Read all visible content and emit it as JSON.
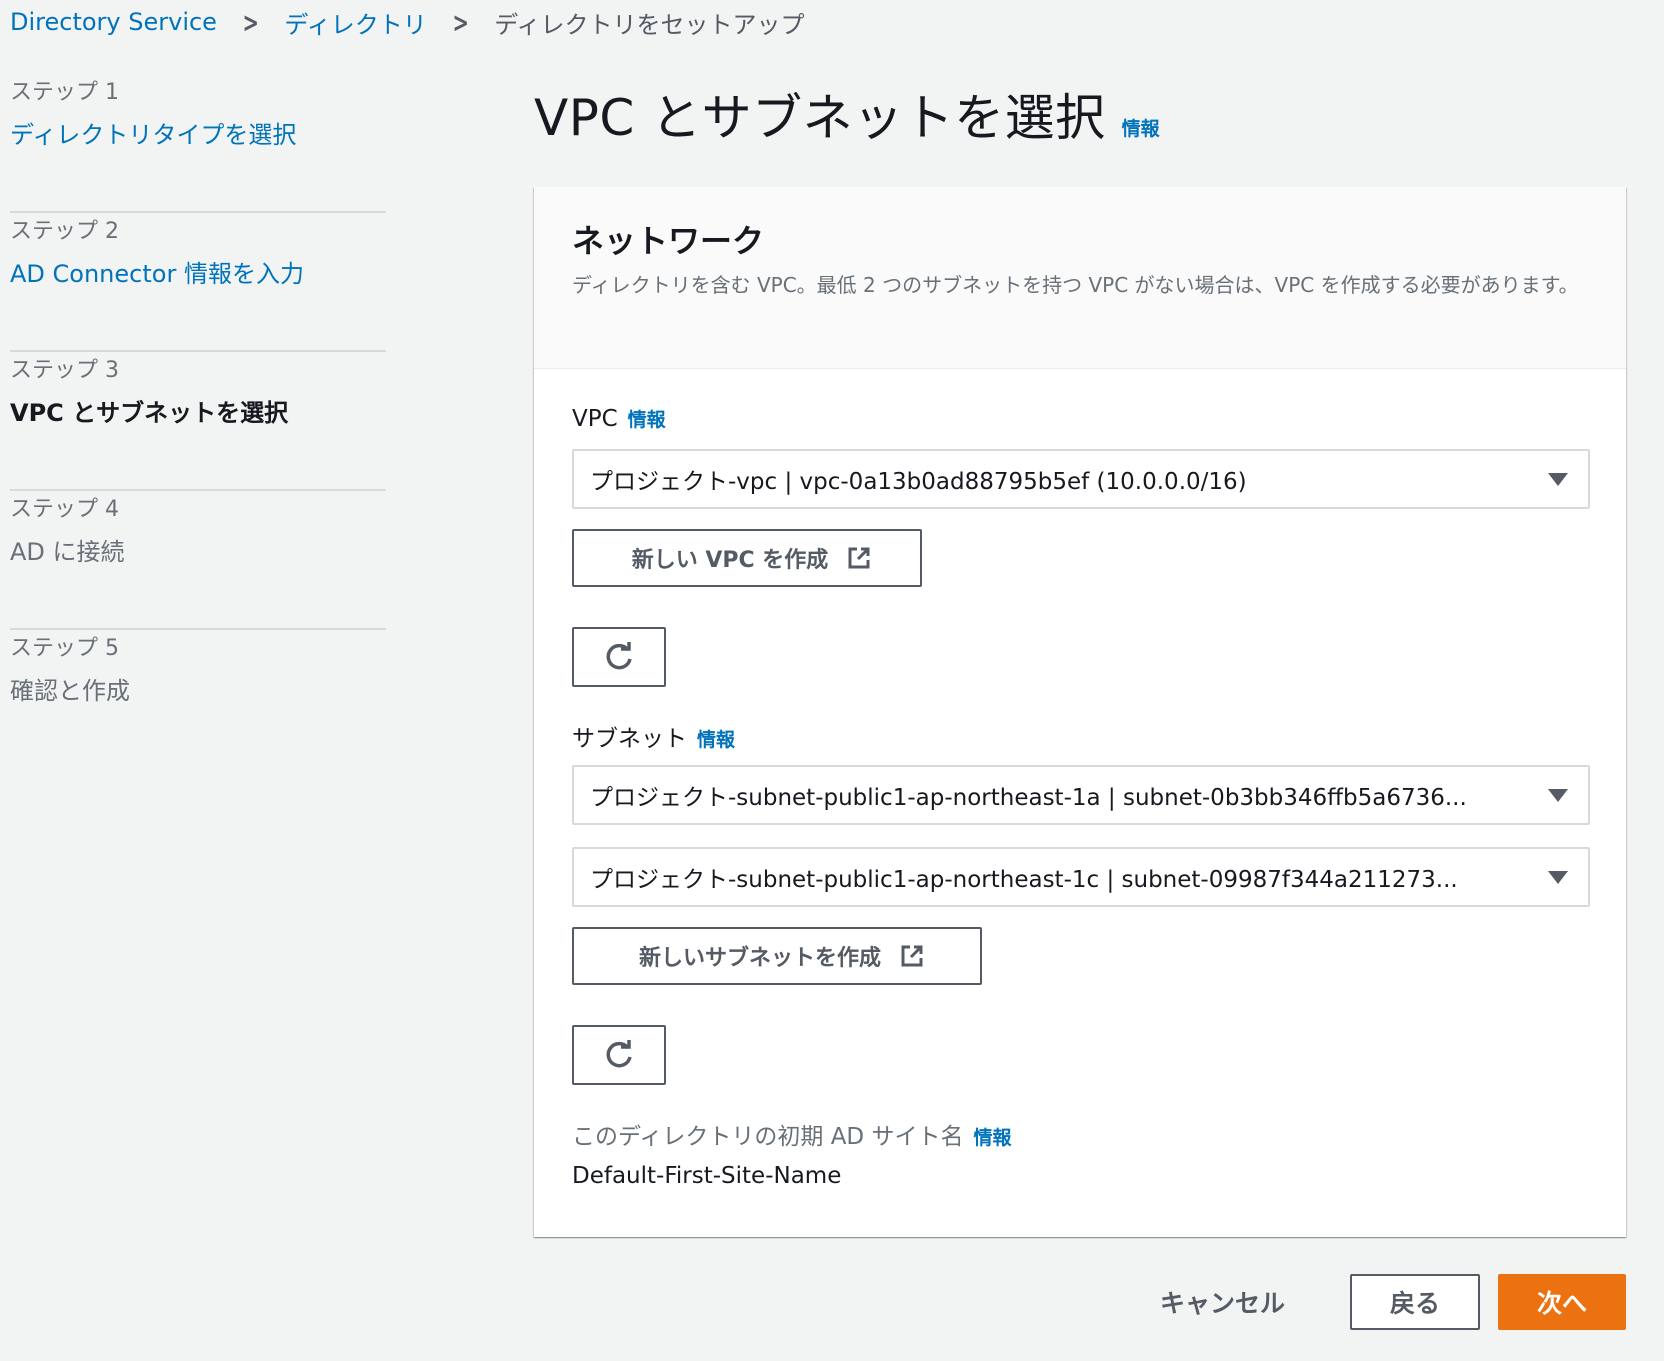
{
  "breadcrumb": {
    "items": [
      "Directory Service",
      "ディレクトリ"
    ],
    "current": "ディレクトリをセットアップ"
  },
  "steps": [
    {
      "label": "ステップ 1",
      "title": "ディレクトリタイプを選択",
      "state": "link"
    },
    {
      "label": "ステップ 2",
      "title": "AD Connector 情報を入力",
      "state": "link"
    },
    {
      "label": "ステップ 3",
      "title": "VPC とサブネットを選択",
      "state": "current"
    },
    {
      "label": "ステップ 4",
      "title": "AD に接続",
      "state": "disabled"
    },
    {
      "label": "ステップ 5",
      "title": "確認と作成",
      "state": "disabled"
    }
  ],
  "page": {
    "title": "VPC とサブネットを選択",
    "info": "情報"
  },
  "network": {
    "heading": "ネットワーク",
    "description": "ディレクトリを含む VPC。最低 2 つのサブネットを持つ VPC がない場合は、VPC を作成する必要があります。",
    "vpc": {
      "label": "VPC",
      "info": "情報",
      "selected": "プロジェクト-vpc | vpc-0a13b0ad88795b5ef (10.0.0.0/16)",
      "create_label": "新しい VPC を作成"
    },
    "subnet": {
      "label": "サブネット",
      "info": "情報",
      "selected_1": "プロジェクト-subnet-public1-ap-northeast-1a | subnet-0b3bb346ffb5a6736...",
      "selected_2": "プロジェクト-subnet-public1-ap-northeast-1c | subnet-09987f344a211273...",
      "create_label": "新しいサブネットを作成"
    },
    "site": {
      "label": "このディレクトリの初期 AD サイト名",
      "info": "情報",
      "value": "Default-First-Site-Name"
    }
  },
  "footer": {
    "cancel_label": "キャンセル",
    "back_label": "戻る",
    "next_label": "次へ"
  },
  "colors": {
    "link": "#0073bb",
    "primary": "#ec7211",
    "text": "#16191f",
    "muted": "#687078"
  },
  "icons": {
    "external": "external-link-icon",
    "refresh": "refresh-icon",
    "caret": "caret-down-icon"
  }
}
